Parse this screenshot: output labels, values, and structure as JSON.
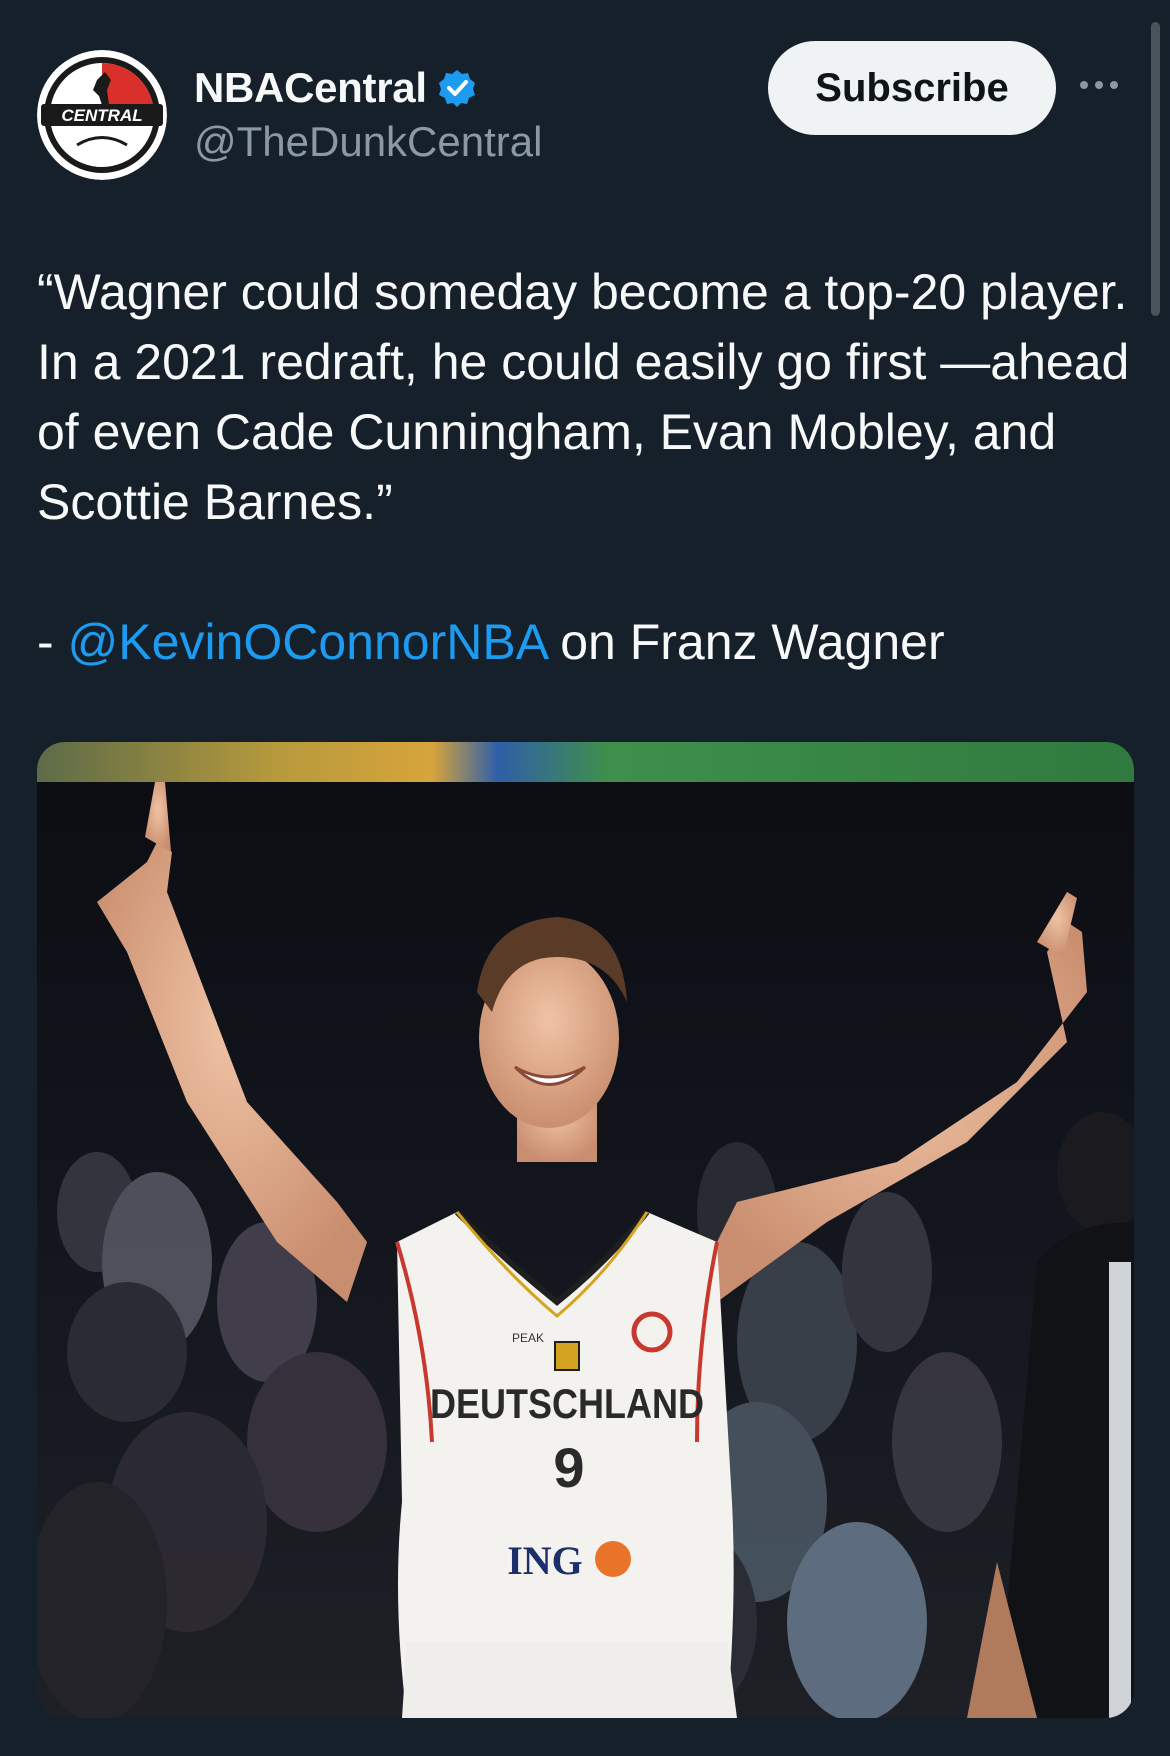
{
  "author": {
    "display_name": "NBACentral",
    "handle": "@TheDunkCentral",
    "avatar_text": "CENTRAL",
    "verified_icon": "verified-badge-icon"
  },
  "actions": {
    "subscribe_label": "Subscribe",
    "more_icon": "more-options-icon"
  },
  "tweet": {
    "quote": "“Wagner could someday become a top-20 player. In a 2021 redraft, he could easily go first —ahead of even Cade Cunningham, Evan Mobley, and Scottie Barnes.”",
    "attribution_prefix": "- ",
    "mention": "@KevinOConnorNBA",
    "attribution_suffix": " on Franz Wagner"
  },
  "media": {
    "jersey_text": "DEUTSCHLAND",
    "jersey_number": "9",
    "sponsor_text": "ING",
    "brand_text": "PEAK"
  },
  "colors": {
    "background": "#15202b",
    "text": "#f7f9f9",
    "secondary": "#8b98a5",
    "link": "#1d9bf0",
    "verified": "#1d9bf0"
  }
}
